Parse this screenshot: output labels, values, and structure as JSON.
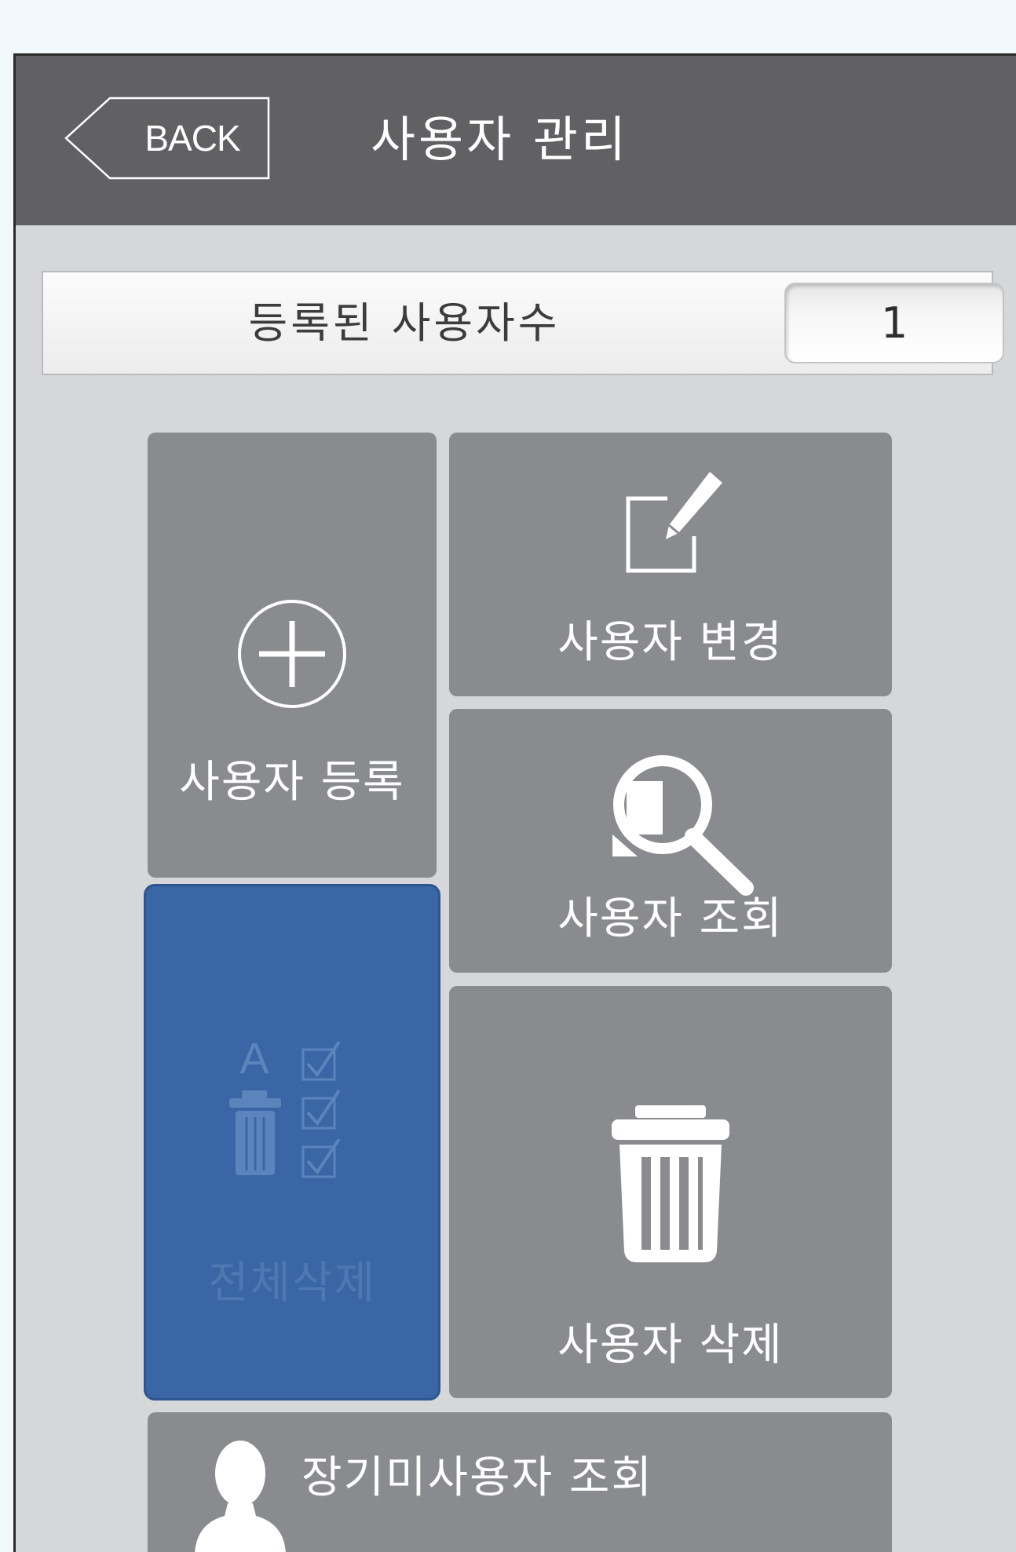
{
  "header": {
    "back_label": "BACK",
    "title": "사용자 관리"
  },
  "user_count": {
    "label": "등록된 사용자수",
    "value": "1"
  },
  "menu": {
    "register_label": "사용자 등록",
    "change_label": "사용자 변경",
    "search_label": "사용자 조회",
    "delete_all_label": "전체삭제",
    "delete_label": "사용자 삭제",
    "longterm_label": "장기미사용자 조회"
  },
  "colors": {
    "header_bg": "#616163",
    "tile_bg": "#8a8b8e",
    "selected_tile_bg": "#3a66a5",
    "screen_bg": "#d6d7d9"
  }
}
